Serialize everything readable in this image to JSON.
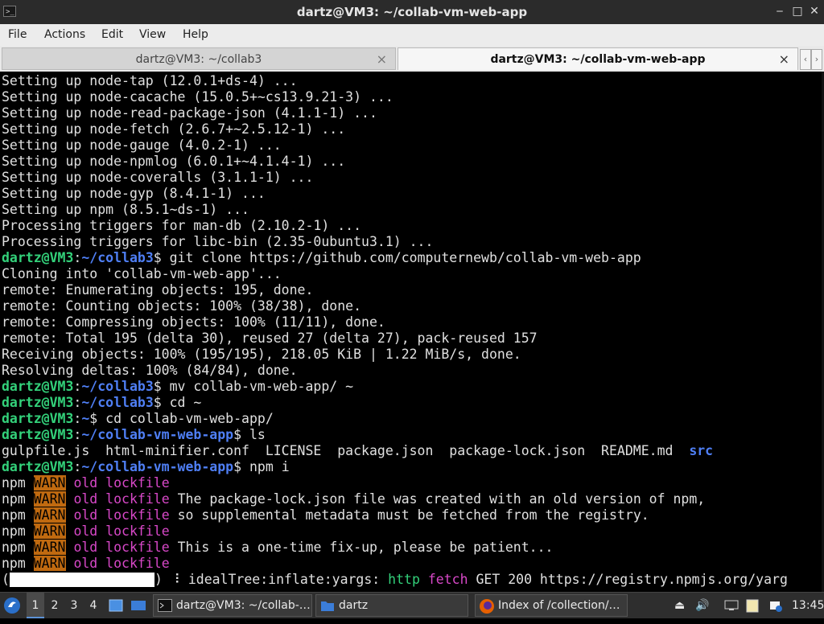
{
  "window": {
    "title": "dartz@VM3: ~/collab-vm-web-app",
    "controls": [
      "‒",
      "□",
      "✕"
    ]
  },
  "menu": [
    "File",
    "Actions",
    "Edit",
    "View",
    "Help"
  ],
  "tabs": [
    {
      "label": "dartz@VM3: ~/collab3",
      "active": false
    },
    {
      "label": "dartz@VM3: ~/collab-vm-web-app",
      "active": true
    }
  ],
  "terminal": {
    "lines": [
      [
        {
          "t": "Setting up node-tap (12.0.1+ds-4) ..."
        }
      ],
      [
        {
          "t": "Setting up node-cacache (15.0.5+~cs13.9.21-3) ..."
        }
      ],
      [
        {
          "t": "Setting up node-read-package-json (4.1.1-1) ..."
        }
      ],
      [
        {
          "t": "Setting up node-fetch (2.6.7+~2.5.12-1) ..."
        }
      ],
      [
        {
          "t": "Setting up node-gauge (4.0.2-1) ..."
        }
      ],
      [
        {
          "t": "Setting up node-npmlog (6.0.1+~4.1.4-1) ..."
        }
      ],
      [
        {
          "t": "Setting up node-coveralls (3.1.1-1) ..."
        }
      ],
      [
        {
          "t": "Setting up node-gyp (8.4.1-1) ..."
        }
      ],
      [
        {
          "t": "Setting up npm (8.5.1~ds-1) ..."
        }
      ],
      [
        {
          "t": "Processing triggers for man-db (2.10.2-1) ..."
        }
      ],
      [
        {
          "t": "Processing triggers for libc-bin (2.35-0ubuntu3.1) ..."
        }
      ],
      [
        {
          "t": "dartz@VM3",
          "c": "pu"
        },
        {
          "t": ":"
        },
        {
          "t": "~/collab3",
          "c": "pp"
        },
        {
          "t": "$ git clone https://github.com/computernewb/collab-vm-web-app"
        }
      ],
      [
        {
          "t": "Cloning into 'collab-vm-web-app'..."
        }
      ],
      [
        {
          "t": "remote: Enumerating objects: 195, done."
        }
      ],
      [
        {
          "t": "remote: Counting objects: 100% (38/38), done."
        }
      ],
      [
        {
          "t": "remote: Compressing objects: 100% (11/11), done."
        }
      ],
      [
        {
          "t": "remote: Total 195 (delta 30), reused 27 (delta 27), pack-reused 157"
        }
      ],
      [
        {
          "t": "Receiving objects: 100% (195/195), 218.05 KiB | 1.22 MiB/s, done."
        }
      ],
      [
        {
          "t": "Resolving deltas: 100% (84/84), done."
        }
      ],
      [
        {
          "t": "dartz@VM3",
          "c": "pu"
        },
        {
          "t": ":"
        },
        {
          "t": "~/collab3",
          "c": "pp"
        },
        {
          "t": "$ mv collab-vm-web-app/ ~"
        }
      ],
      [
        {
          "t": "dartz@VM3",
          "c": "pu"
        },
        {
          "t": ":"
        },
        {
          "t": "~/collab3",
          "c": "pp"
        },
        {
          "t": "$ cd ~"
        }
      ],
      [
        {
          "t": "dartz@VM3",
          "c": "pu"
        },
        {
          "t": ":"
        },
        {
          "t": "~",
          "c": "pp"
        },
        {
          "t": "$ cd collab-vm-web-app/"
        }
      ],
      [
        {
          "t": "dartz@VM3",
          "c": "pu"
        },
        {
          "t": ":"
        },
        {
          "t": "~/collab-vm-web-app",
          "c": "pp"
        },
        {
          "t": "$ ls"
        }
      ],
      [
        {
          "t": "gulpfile.js  html-minifier.conf  LICENSE  package.json  package-lock.json  README.md  "
        },
        {
          "t": "src",
          "c": "blue"
        }
      ],
      [
        {
          "t": "dartz@VM3",
          "c": "pu"
        },
        {
          "t": ":"
        },
        {
          "t": "~/collab-vm-web-app",
          "c": "pp"
        },
        {
          "t": "$ npm i"
        }
      ],
      [
        {
          "t": "npm "
        },
        {
          "t": "WARN",
          "c": "wa"
        },
        {
          "t": " "
        },
        {
          "t": "old lockfile",
          "c": "mg"
        }
      ],
      [
        {
          "t": "npm "
        },
        {
          "t": "WARN",
          "c": "wa"
        },
        {
          "t": " "
        },
        {
          "t": "old lockfile",
          "c": "mg"
        },
        {
          "t": " The package-lock.json file was created with an old version of npm,"
        }
      ],
      [
        {
          "t": "npm "
        },
        {
          "t": "WARN",
          "c": "wa"
        },
        {
          "t": " "
        },
        {
          "t": "old lockfile",
          "c": "mg"
        },
        {
          "t": " so supplemental metadata must be fetched from the registry."
        }
      ],
      [
        {
          "t": "npm "
        },
        {
          "t": "WARN",
          "c": "wa"
        },
        {
          "t": " "
        },
        {
          "t": "old lockfile",
          "c": "mg"
        }
      ],
      [
        {
          "t": "npm "
        },
        {
          "t": "WARN",
          "c": "wa"
        },
        {
          "t": " "
        },
        {
          "t": "old lockfile",
          "c": "mg"
        },
        {
          "t": " This is a one-time fix-up, please be patient..."
        }
      ],
      [
        {
          "t": "npm "
        },
        {
          "t": "WARN",
          "c": "wa"
        },
        {
          "t": " "
        },
        {
          "t": "old lockfile",
          "c": "mg"
        }
      ],
      [
        {
          "t": "("
        },
        {
          "t": "",
          "c": "pb"
        },
        {
          "t": ") ⠸ idealTree:inflate:yargs: "
        },
        {
          "t": "http",
          "c": "gr"
        },
        {
          "t": " "
        },
        {
          "t": "fetch",
          "c": "mg"
        },
        {
          "t": " GET 200 https://registry.npmjs.org/yarg"
        }
      ]
    ]
  },
  "taskbar": {
    "workspaces": [
      "1",
      "2",
      "3",
      "4"
    ],
    "tasks": [
      {
        "label": "dartz@VM3: ~/collab-…",
        "icon": "terminal-icon"
      },
      {
        "label": "dartz",
        "icon": "folder-icon"
      },
      {
        "label": "Index of /collection/…",
        "icon": "firefox-icon"
      }
    ],
    "clock": "13:45"
  }
}
